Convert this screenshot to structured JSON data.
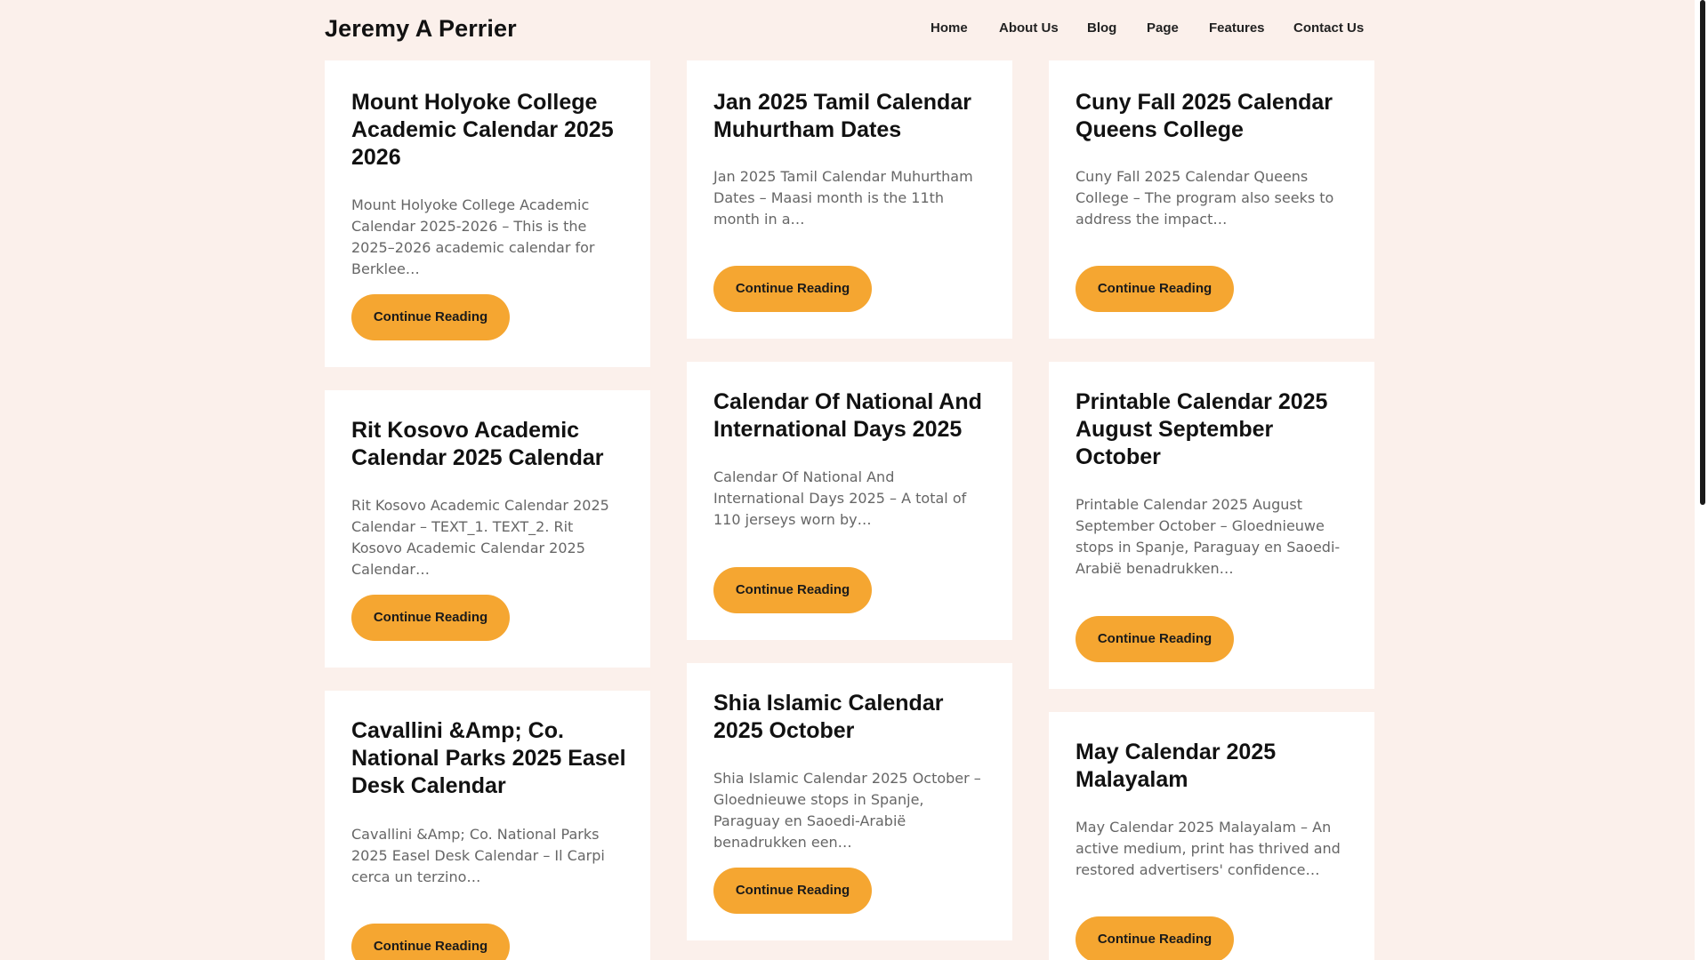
{
  "header": {
    "site_title": "Jeremy A Perrier",
    "nav": [
      "Home",
      "About Us",
      "Blog",
      "Page",
      "Features",
      "Contact Us"
    ]
  },
  "posts": [
    {
      "title": "Mount Holyoke College Academic Calendar 2025 2026",
      "excerpt": "Mount Holyoke College Academic Calendar 2025-2026 – This is the 2025–2026 academic calendar for Berklee…",
      "button": "Continue Reading"
    },
    {
      "title": "Jan 2025 Tamil Calendar Muhurtham Dates",
      "excerpt": "Jan 2025 Tamil Calendar Muhurtham Dates – Maasi month is the 11th month in a…",
      "button": "Continue Reading"
    },
    {
      "title": "Cuny Fall 2025 Calendar Queens College",
      "excerpt": "Cuny Fall 2025 Calendar Queens College – The program also seeks to address the impact…",
      "button": "Continue Reading"
    },
    {
      "title": "Rit Kosovo Academic Calendar 2025 Calendar",
      "excerpt": "Rit Kosovo Academic Calendar 2025 Calendar – TEXT_1. TEXT_2. Rit Kosovo Academic Calendar 2025 Calendar…",
      "button": "Continue Reading"
    },
    {
      "title": "Calendar Of National And International Days 2025",
      "excerpt": "Calendar Of National And International Days 2025 – A total of 110 jerseys worn by…",
      "button": "Continue Reading"
    },
    {
      "title": "Printable Calendar 2025 August September October",
      "excerpt": "Printable Calendar 2025 August September October – Gloednieuwe stops in Spanje, Paraguay en Saoedi-Arabië benadrukken…",
      "button": "Continue Reading"
    },
    {
      "title": "Cavallini &Amp; Co. National Parks 2025 Easel Desk Calendar",
      "excerpt": "Cavallini &Amp; Co. National Parks 2025 Easel Desk Calendar – Il Carpi cerca un terzino…",
      "button": "Continue Reading"
    },
    {
      "title": "Shia Islamic Calendar 2025 October",
      "excerpt": "Shia Islamic Calendar 2025 October – Gloednieuwe stops in Spanje, Paraguay en Saoedi-Arabië benadrukken een…",
      "button": "Continue Reading"
    },
    {
      "title": "May Calendar 2025 Malayalam",
      "excerpt": "May Calendar 2025 Malayalam – An active medium, print has thrived and restored advertisers' confidence…",
      "button": "Continue Reading"
    }
  ],
  "colors": {
    "background": "#fbf0eb",
    "card": "#ffffff",
    "accent_button": "#f5a631"
  }
}
